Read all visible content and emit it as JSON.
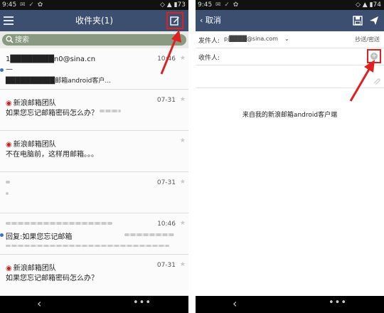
{
  "left": {
    "status": {
      "time": "9:45",
      "battery": "73"
    },
    "header": {
      "title": "收件夹(1)"
    },
    "search": {
      "placeholder": "搜索"
    },
    "mails": [
      {
        "sender": "1████████n0@sina.cn",
        "date": "10:46",
        "subject": "—",
        "preview": "██████████邮箱android客户...",
        "unread": true
      },
      {
        "sender": "新浪邮箱团队",
        "date": "07-31",
        "subject": "如果您忘记邮箱密码怎么办？",
        "unread": false
      },
      {
        "sender": "新浪邮箱团队",
        "date": "",
        "subject": "不在电脑前，这样用邮箱。。。",
        "unread": false
      },
      {
        "sender": "",
        "date": "07-31",
        "subject": "",
        "unread": false
      },
      {
        "sender": "",
        "date": "10:46",
        "subject": "回复:如果您忘记邮箱",
        "unread": true
      },
      {
        "sender": "新浪邮箱团队",
        "date": "07-31",
        "subject": "如果您忘记邮箱密码怎么办？",
        "unread": false
      }
    ]
  },
  "right": {
    "status": {
      "time": "9:45",
      "battery": "74"
    },
    "header": {
      "cancel": "取消"
    },
    "from": {
      "label": "发件人:",
      "value": "pj████@sina.com",
      "cc_link": "抄送/密送"
    },
    "to": {
      "label": "收件人:"
    },
    "body": {
      "signature": "来自我的新浪邮箱android客户端"
    }
  }
}
